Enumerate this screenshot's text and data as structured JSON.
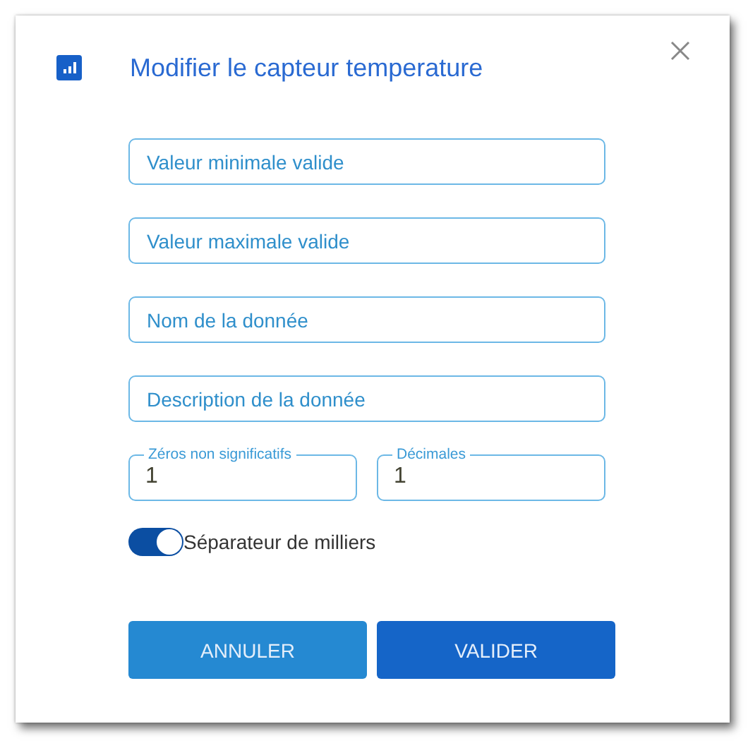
{
  "dialog": {
    "title": "Modifier le capteur temperature"
  },
  "fields": [
    {
      "placeholder": "Valeur minimale valide"
    },
    {
      "placeholder": "Valeur maximale valide"
    },
    {
      "placeholder": "Nom de la donnée"
    },
    {
      "placeholder": "Description de la donnée"
    }
  ],
  "number_fields": [
    {
      "label": "Zéros non significatifs",
      "value": "1"
    },
    {
      "label": "Décimales",
      "value": "1"
    }
  ],
  "toggle": {
    "label": "Séparateur de milliers",
    "on": true
  },
  "buttons": [
    {
      "label": "ANNULER",
      "kind": "secondary"
    },
    {
      "label": "VALIDER",
      "kind": "primary"
    }
  ]
}
